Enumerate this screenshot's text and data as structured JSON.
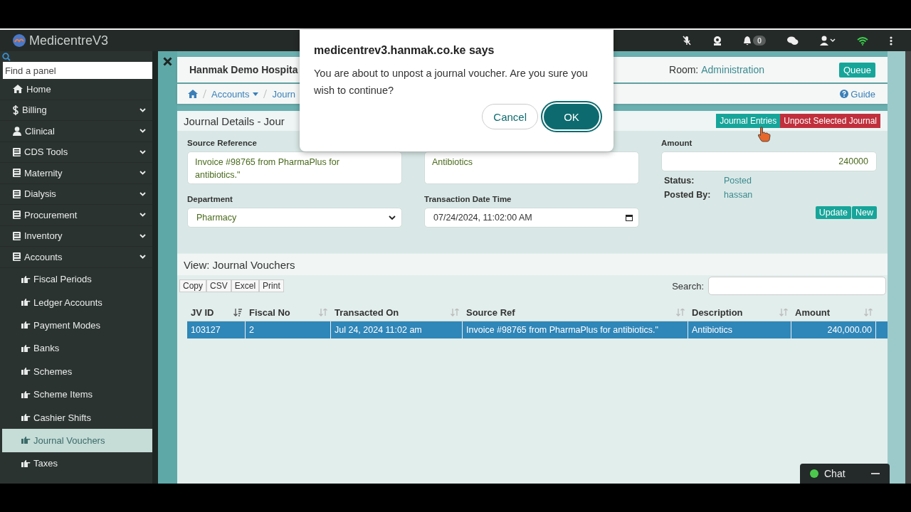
{
  "app": {
    "name": "MedicentreV3"
  },
  "topbar": {
    "notifications": "0"
  },
  "sidebar": {
    "search": {
      "placeholder": "Find a panel"
    },
    "items": [
      {
        "label": "Home",
        "kind": "link"
      },
      {
        "label": "Billing",
        "kind": "menu",
        "expanded": false
      },
      {
        "label": "Clinical",
        "kind": "menu",
        "expanded": false
      },
      {
        "label": "CDS Tools",
        "kind": "menu",
        "expanded": false
      },
      {
        "label": "Maternity",
        "kind": "menu",
        "expanded": false
      },
      {
        "label": "Dialysis",
        "kind": "menu",
        "expanded": false
      },
      {
        "label": "Procurement",
        "kind": "menu",
        "expanded": false
      },
      {
        "label": "Inventory",
        "kind": "menu",
        "expanded": false
      },
      {
        "label": "Accounts",
        "kind": "menu",
        "expanded": true,
        "children": [
          {
            "label": "Fiscal Periods",
            "selected": false
          },
          {
            "label": "Ledger Accounts",
            "selected": false
          },
          {
            "label": "Payment Modes",
            "selected": false
          },
          {
            "label": "Banks",
            "selected": false
          },
          {
            "label": "Schemes",
            "selected": false
          },
          {
            "label": "Scheme Items",
            "selected": false
          },
          {
            "label": "Cashier Shifts",
            "selected": false
          },
          {
            "label": "Journal Vouchers",
            "selected": true
          },
          {
            "label": "Taxes",
            "selected": false
          }
        ]
      }
    ]
  },
  "header": {
    "hospital": "Hanmak Demo Hospita",
    "room_label": "Room:",
    "room": "Administration",
    "queue_button": "Queue"
  },
  "breadcrumb": {
    "items": [
      {
        "label": "Accounts",
        "dropdown": true
      },
      {
        "label": "Journ",
        "dropdown": false
      }
    ],
    "guide": "Guide"
  },
  "journal": {
    "title": "Journal Details - Jour",
    "actions": [
      "Journal Entries",
      "Unpost Selected Journal"
    ],
    "source_reference": {
      "label": "Source Reference",
      "value": "Invoice #98765 from PharmaPlus for antibiotics.\""
    },
    "description": {
      "value": "Antibiotics"
    },
    "department": {
      "label": "Department",
      "value": "Pharmacy"
    },
    "transaction_date": {
      "label": "Transaction Date Time",
      "value": "07/24/2024, 11:02:00 AM"
    },
    "amount": {
      "label": "Amount",
      "value": "240000"
    },
    "status_label": "Status:",
    "status": "Posted",
    "posted_by_label": "Posted By:",
    "posted_by": "hassan",
    "buttons": [
      "Update",
      "New"
    ]
  },
  "vouchers": {
    "title": "View: Journal Vouchers",
    "export_buttons": [
      "Copy",
      "CSV",
      "Excel",
      "Print"
    ],
    "search_label": "Search:",
    "columns": [
      {
        "label": "JV ID",
        "sorted": true
      },
      {
        "label": "Fiscal No",
        "sorted": false
      },
      {
        "label": "Transacted On",
        "sorted": false
      },
      {
        "label": "Source Ref",
        "sorted": false
      },
      {
        "label": "Description",
        "sorted": false
      },
      {
        "label": "Amount",
        "sorted": false
      }
    ],
    "rows": [
      {
        "cells": [
          "103127",
          "2",
          "Jul 24, 2024 11:02 am",
          "Invoice #98765 from PharmaPlus for antibiotics.\"",
          "Antibiotics",
          "240,000.00"
        ],
        "selected": true
      }
    ]
  },
  "chat": {
    "label": "Chat",
    "online": true
  },
  "dialog": {
    "title": "medicentrev3.hanmak.co.ke says",
    "message": "You are about to unpost a journal voucher. Are you sure you wish to continue?",
    "cancel": "Cancel",
    "ok": "OK"
  }
}
